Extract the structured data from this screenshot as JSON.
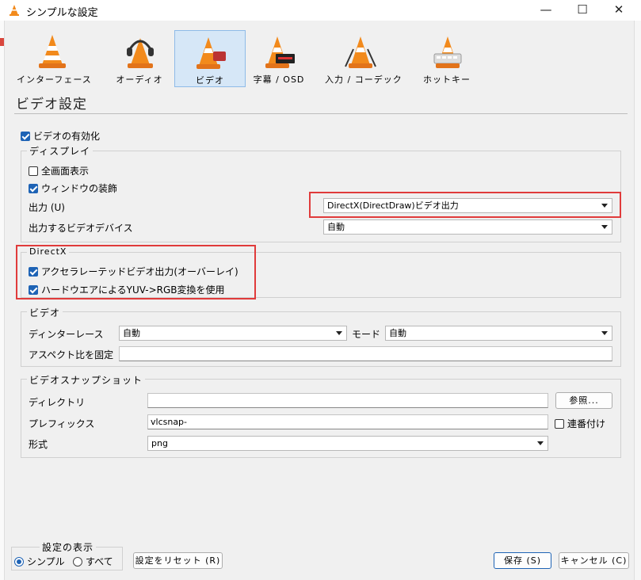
{
  "window": {
    "title": "シンプルな設定",
    "minimize": "—",
    "maximize": "☐",
    "close": "✕"
  },
  "categories": [
    {
      "label": "インターフェース",
      "icon": "vlc-cone-icon"
    },
    {
      "label": "オーディオ",
      "icon": "headphones-cone-icon"
    },
    {
      "label": "ビデオ",
      "icon": "video-cone-icon",
      "selected": true
    },
    {
      "label": "字幕 / OSD",
      "icon": "subtitle-cone-icon"
    },
    {
      "label": "入力 / コーデック",
      "icon": "input-codec-cone-icon"
    },
    {
      "label": "ホットキー",
      "icon": "hotkeys-cone-icon"
    }
  ],
  "page_title": "ビデオ設定",
  "enable_video": {
    "label": "ビデオの有効化",
    "checked": true
  },
  "display": {
    "title": "ディスプレイ",
    "fullscreen": {
      "label": "全画面表示",
      "checked": false
    },
    "decorations": {
      "label": "ウィンドウの装飾",
      "checked": true
    },
    "output_label": "出力 (U)",
    "output_value": "DirectX(DirectDraw)ビデオ出力",
    "device_label": "出力するビデオデバイス",
    "device_value": "自動"
  },
  "directx": {
    "title": "DirectX",
    "overlay": {
      "label": "アクセラレーテッドビデオ出力(オーバーレイ)",
      "checked": true
    },
    "yuv": {
      "label": "ハードウエアによるYUV->RGB変換を使用",
      "checked": true
    }
  },
  "video": {
    "title": "ビデオ",
    "deinterlace_label": "ディンターレース",
    "deinterlace_value": "自動",
    "mode_label": "モード",
    "mode_value": "自動",
    "aspect_label": "アスペクト比を固定",
    "aspect_value": ""
  },
  "snapshot": {
    "title": "ビデオスナップショット",
    "directory_label": "ディレクトリ",
    "directory_value": "",
    "browse_label": "参照...",
    "prefix_label": "プレフィックス",
    "prefix_value": "vlcsnap-",
    "sequential": {
      "label": "連番付け",
      "checked": false
    },
    "format_label": "形式",
    "format_value": "png"
  },
  "show_settings": {
    "title": "設定の表示",
    "simple": "シンプル",
    "all": "すべて",
    "selected": "simple"
  },
  "buttons": {
    "reset": "設定をリセット (R)",
    "save": "保存 (S)",
    "cancel": "キャンセル (C)"
  },
  "colors": {
    "accent": "#1e63b5",
    "highlight": "#e03b3b",
    "selected_bg": "#d6e7f7",
    "cone_orange": "#f28a1c"
  }
}
